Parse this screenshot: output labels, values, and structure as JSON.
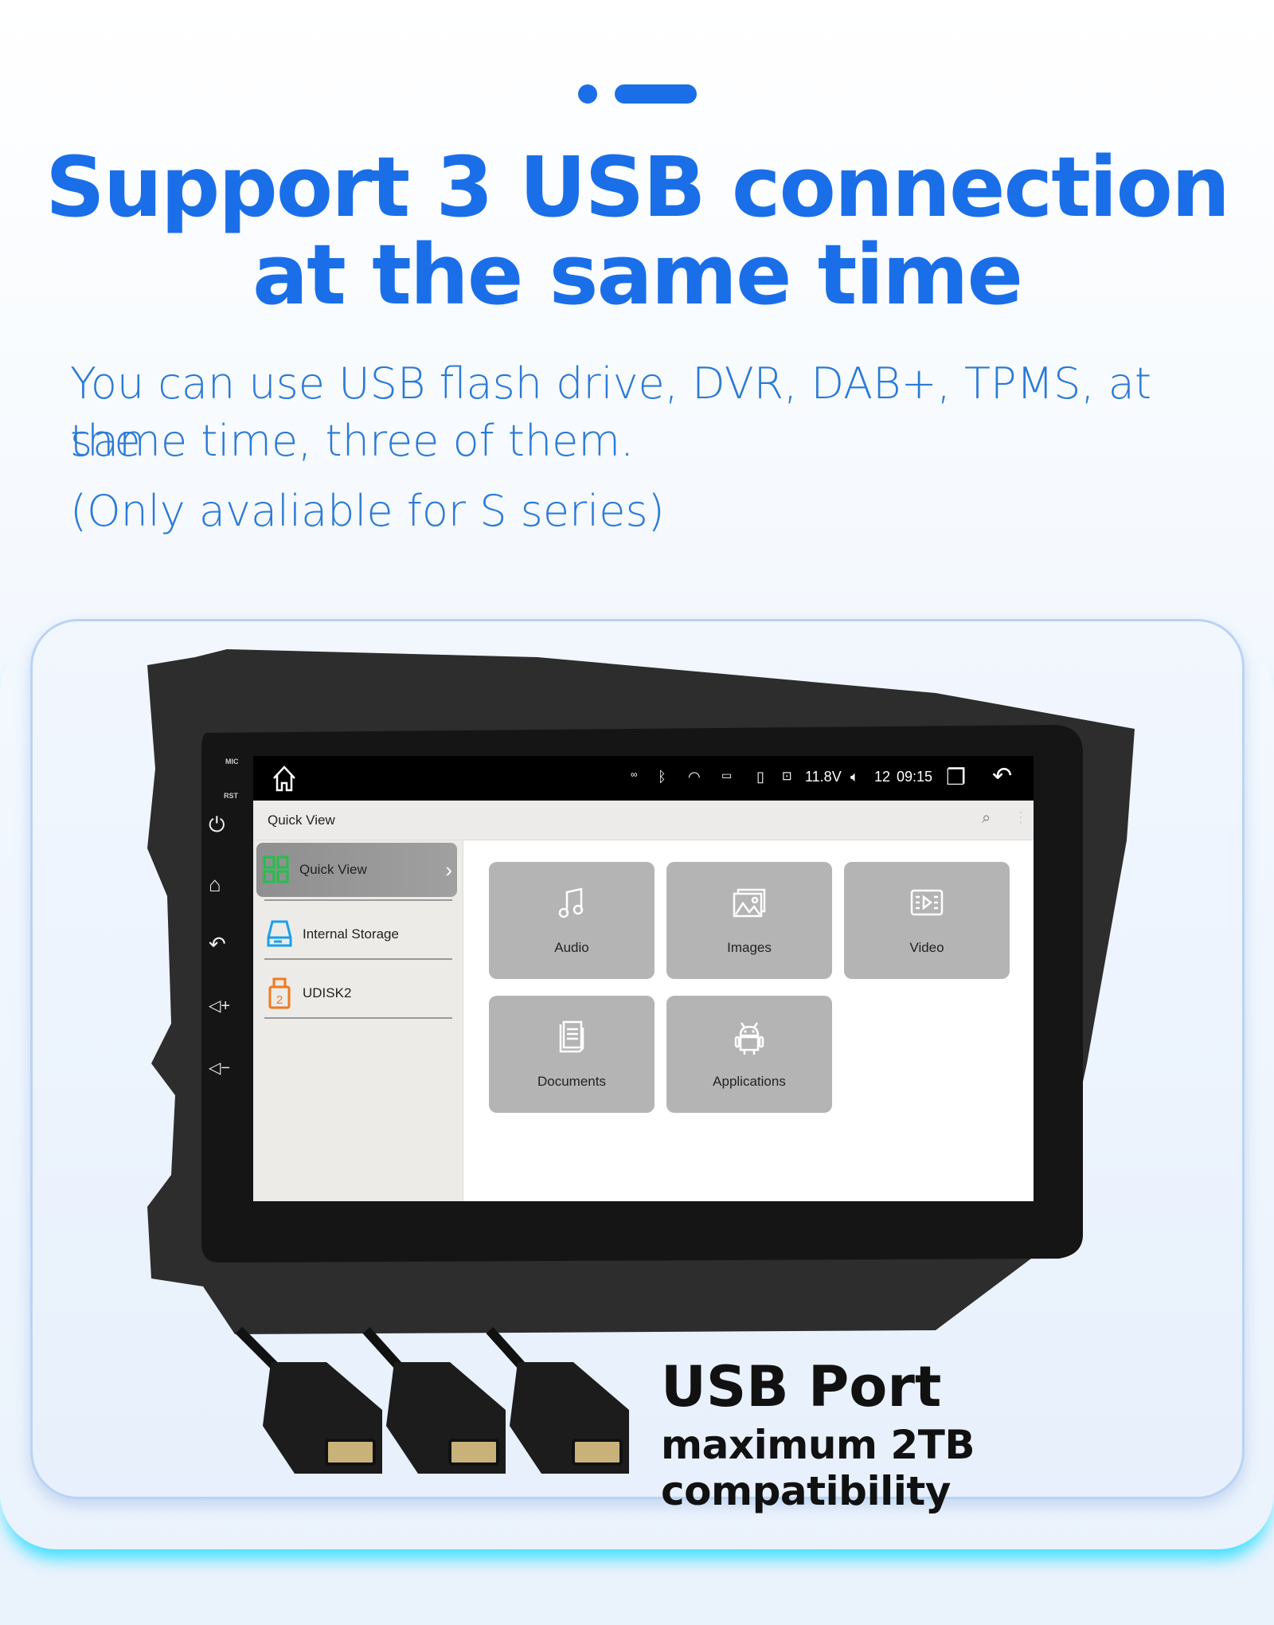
{
  "header": {
    "title_line1": "Support 3 USB connection",
    "title_line2": "at the same time",
    "description_line1": "You can use USB flash drive, DVR, DAB+, TPMS, at the",
    "description_line2": "same time, three of them.",
    "note": "(Only avaliable for S series)"
  },
  "colors": {
    "brand": "#1a6fe8",
    "text_blue": "#2a7ad6",
    "glow": "#3fe0ff"
  },
  "device": {
    "panel_labels": {
      "mic": "MIC",
      "rst": "RST"
    },
    "panel_buttons": [
      "power-icon",
      "home-icon",
      "back-icon",
      "volume-up-icon",
      "volume-down-icon"
    ],
    "status_bar": {
      "voltage": "11.8V",
      "volume": "12",
      "time": "09:15"
    },
    "toolbar": {
      "title": "Quick View"
    },
    "sidebar": {
      "items": [
        {
          "label": "Quick View",
          "active": true
        },
        {
          "label": "Internal Storage"
        },
        {
          "label": "UDISK2"
        }
      ]
    },
    "tiles": [
      {
        "label": "Audio"
      },
      {
        "label": "Images"
      },
      {
        "label": "Video"
      },
      {
        "label": "Documents"
      },
      {
        "label": "Applications"
      }
    ]
  },
  "usb": {
    "title": "USB Port",
    "subtitle": "maximum 2TB compatibility",
    "port_count": 3
  }
}
